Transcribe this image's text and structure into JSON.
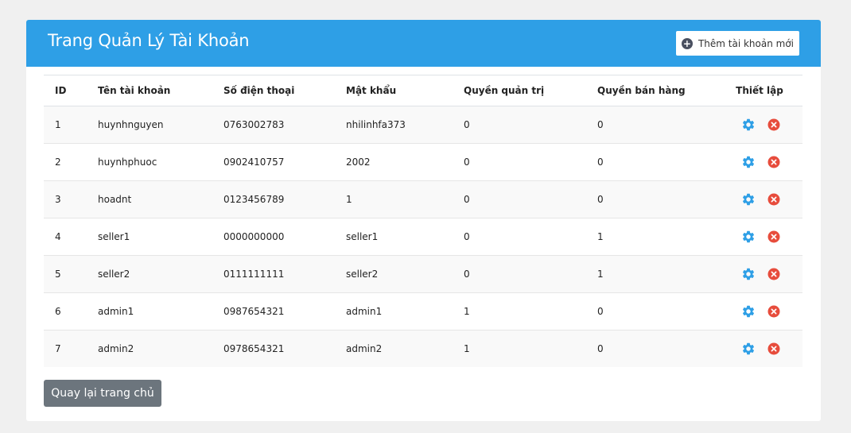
{
  "header": {
    "title": "Trang Quản Lý Tài Khoản",
    "add_button_label": "Thêm tài khoản mới",
    "add_icon": "plus-circle-icon"
  },
  "colors": {
    "header_bg": "#2e9fe6",
    "gear": "#2e9fe6",
    "delete": "#e74c3c",
    "back_button": "#6c757d"
  },
  "table": {
    "columns": [
      "ID",
      "Tên tài khoản",
      "Số điện thoại",
      "Mật khẩu",
      "Quyền quản trị",
      "Quyền bán hàng",
      "Thiết lập"
    ],
    "rows": [
      {
        "id": "1",
        "username": "huynhnguyen",
        "phone": "0763002783",
        "password": "nhilinhfa373",
        "admin": "0",
        "seller": "0"
      },
      {
        "id": "2",
        "username": "huynhphuoc",
        "phone": "0902410757",
        "password": "2002",
        "admin": "0",
        "seller": "0"
      },
      {
        "id": "3",
        "username": "hoadnt",
        "phone": "0123456789",
        "password": "1",
        "admin": "0",
        "seller": "0"
      },
      {
        "id": "4",
        "username": "seller1",
        "phone": "0000000000",
        "password": "seller1",
        "admin": "0",
        "seller": "1"
      },
      {
        "id": "5",
        "username": "seller2",
        "phone": "0111111111",
        "password": "seller2",
        "admin": "0",
        "seller": "1"
      },
      {
        "id": "6",
        "username": "admin1",
        "phone": "0987654321",
        "password": "admin1",
        "admin": "1",
        "seller": "0"
      },
      {
        "id": "7",
        "username": "admin2",
        "phone": "0978654321",
        "password": "admin2",
        "admin": "1",
        "seller": "0"
      }
    ],
    "row_actions": [
      "gear-icon",
      "close-circle-icon"
    ]
  },
  "footer": {
    "back_button_label": "Quay lại trang chủ"
  }
}
